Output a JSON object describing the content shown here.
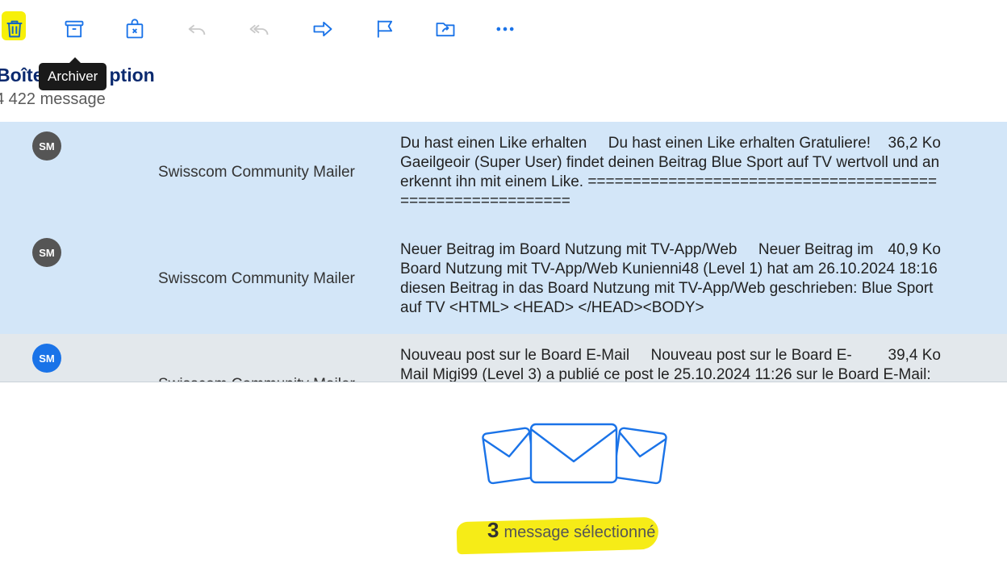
{
  "toolbar": {
    "buttons": [
      {
        "icon": "trash-icon",
        "label": "Supprimer",
        "highlighted": true
      },
      {
        "icon": "archive-icon",
        "label": "Archiver"
      },
      {
        "icon": "spam-bag-icon",
        "label": "Spam"
      },
      {
        "icon": "reply-icon",
        "label": "Répondre",
        "disabled": true
      },
      {
        "icon": "reply-all-icon",
        "label": "Répondre à tous",
        "disabled": true
      },
      {
        "icon": "forward-icon",
        "label": "Transférer"
      },
      {
        "icon": "flag-icon",
        "label": "Marquer"
      },
      {
        "icon": "move-folder-icon",
        "label": "Déplacer"
      },
      {
        "icon": "more-icon",
        "label": "Plus"
      }
    ],
    "tooltip": "Archiver",
    "accent_color": "#1a73e8",
    "highlight_color": "#f7f00a"
  },
  "folder": {
    "title_visible_start": "Boîte",
    "title_visible_end": "ption",
    "count": "4 422 message"
  },
  "messages": [
    {
      "avatar": "SM",
      "avatar_color": "#555555",
      "sender": "Swisscom Community Mailer",
      "subject": "Du hast einen Like erhalten",
      "preview": "Du hast einen Like erhalten Gratuliere! Gaeilgeoir (Super User) findet deinen Beitrag Blue Sport auf TV wertvoll und anerkennt ihn mit einem Like. ==========================================================",
      "size": "36,2 Ko",
      "selected": true
    },
    {
      "avatar": "SM",
      "avatar_color": "#555555",
      "sender": "Swisscom Community Mailer",
      "subject": "Neuer Beitrag im Board Nutzung mit TV-App/Web",
      "preview": "Neuer Beitrag im Board Nutzung mit TV-App/Web Kunienni48 (Level 1) hat am 26.10.2024 18:16 diesen Beitrag in das Board Nutzung mit TV-App/Web geschrieben: Blue Sport auf TV <HTML> <HEAD> </HEAD><BODY>",
      "size": "40,9 Ko",
      "selected": true
    },
    {
      "avatar": "SM",
      "avatar_color": "#1a73e8",
      "sender": "Swisscom Community Mailer",
      "subject": "Nouveau post sur le Board E-Mail",
      "preview": "Nouveau post sur le Board E-Mail Migi99 (Level 3) a publié ce post le 25.10.2024 11:26 sur le Board E-Mail:",
      "size": "39,4 Ko",
      "selected": false
    }
  ],
  "selection": {
    "count": "3",
    "label": "message sélectionné"
  }
}
